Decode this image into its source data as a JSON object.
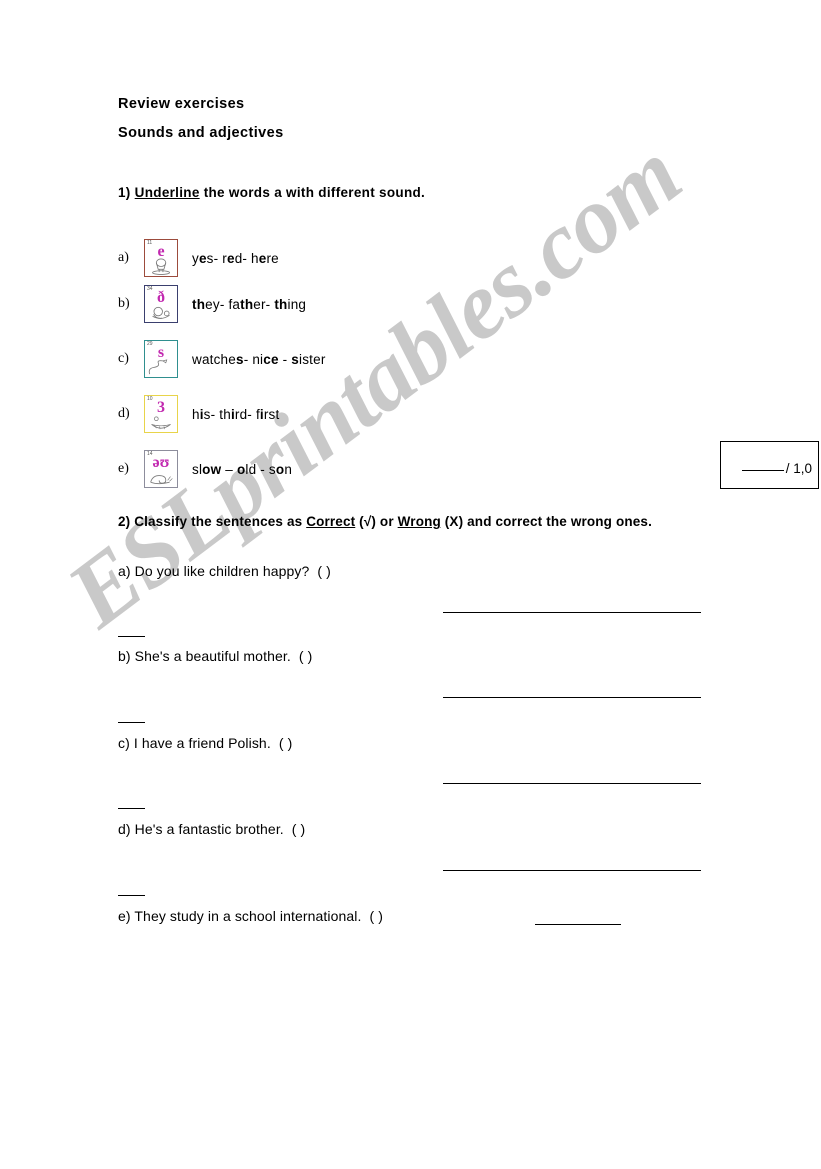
{
  "watermark": {
    "text": "ESLprintables.com"
  },
  "header": {
    "title": "Review exercises",
    "subtitle": "Sounds and adjectives"
  },
  "exercise1": {
    "number": "1)",
    "instruction_underlined": "Underline",
    "instruction_rest": " the  words a with different sound.",
    "items": [
      {
        "label": "a)",
        "card": {
          "number": "11",
          "symbol": "e",
          "border_color": "#9c4b3c",
          "icon_name": "egg-cup-picture"
        },
        "words_html": "y<b>e</b>s- r<b>e</b>d- h<b>e</b>re",
        "words_plain": "yes- red- here"
      },
      {
        "label": "b)",
        "card": {
          "number": "34",
          "symbol": "ð",
          "border_color": "#3a3f6e",
          "icon_name": "mother-baby-picture"
        },
        "words_html": "<b>th</b>ey- fa<b>th</b>er- <b>th</b>ing",
        "words_plain": "they- father- thing"
      },
      {
        "label": "c)",
        "card": {
          "number": "29",
          "symbol": "s",
          "border_color": "#2f8f8f",
          "icon_name": "snake-picture"
        },
        "words_html": "watche<b>s</b>- ni<b>ce</b> - <b>s</b>ister",
        "words_plain": "watches- nice - sister"
      },
      {
        "label": "d)",
        "card": {
          "number": "10",
          "symbol": "3",
          "border_color": "#e8d44a",
          "icon_name": "bird-nest-picture"
        },
        "words_html": "h<b>i</b>s- th<b>i</b>rd- f<b>i</b>rst",
        "words_plain": "his- third- first"
      },
      {
        "label": "e)",
        "card": {
          "number": "14",
          "symbol": "əʊ",
          "border_color": "#8d8d9c",
          "icon_name": "snail-picture"
        },
        "words_html": "sl<b>ow</b> – <b>o</b>ld - s<b>o</b>n",
        "words_plain": "slow – old - son"
      }
    ]
  },
  "score_box": {
    "blank_label": "",
    "value_text": "/ 1,0"
  },
  "exercise2": {
    "number": "2)",
    "instruction_part1": "Classify the sentences as ",
    "instruction_correct": "Correct",
    "instruction_part2": " (√) or ",
    "instruction_wrong": "Wrong",
    "instruction_part3": " (X) and correct the wrong ones.",
    "items": [
      {
        "label": "a)",
        "sentence": "Do you like children happy?",
        "marker": "(    )"
      },
      {
        "label": "b)",
        "sentence": "She's a beautiful mother.",
        "marker": "(   )"
      },
      {
        "label": "c)",
        "sentence": "I have a friend Polish.",
        "marker": "(     )"
      },
      {
        "label": "d)",
        "sentence": "He's a fantastic brother.",
        "marker": "(   )"
      },
      {
        "label": "e)",
        "sentence": "They study in a school international.",
        "marker": "(   )"
      }
    ]
  }
}
